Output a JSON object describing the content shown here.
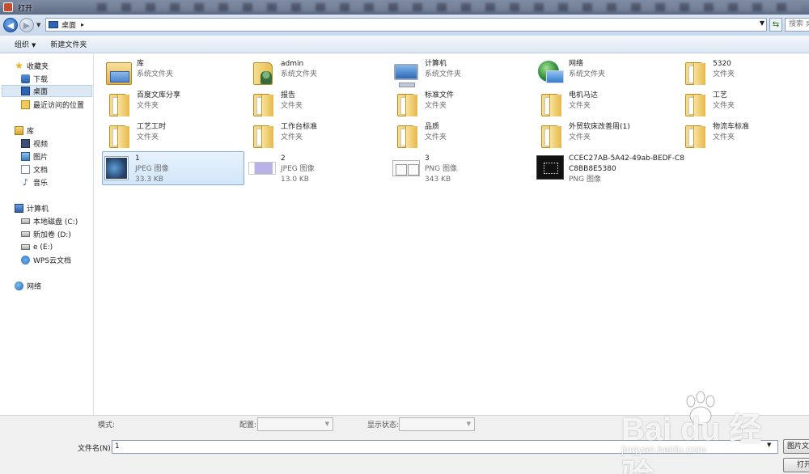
{
  "window": {
    "title": "打开"
  },
  "address": {
    "path": "桌面",
    "search_placeholder": "搜索 桌面"
  },
  "toolbar": {
    "organize": "组织",
    "new_folder": "新建文件夹"
  },
  "sidebar": {
    "favorites": "收藏夹",
    "downloads": "下载",
    "desktop": "桌面",
    "recent": "最近访问的位置",
    "libraries": "库",
    "videos": "视频",
    "pictures": "图片",
    "documents": "文档",
    "music": "音乐",
    "computer": "计算机",
    "drive_c": "本地磁盘 (C:)",
    "drive_d": "新加卷 (D:)",
    "drive_e": "e (E:)",
    "wps_cloud": "WPS云文档",
    "network": "网络"
  },
  "files": [
    {
      "name": "库",
      "type": "系统文件夹"
    },
    {
      "name": "admin",
      "type": "系统文件夹"
    },
    {
      "name": "计算机",
      "type": "系统文件夹"
    },
    {
      "name": "网络",
      "type": "系统文件夹"
    },
    {
      "name": "5320",
      "type": "文件夹"
    },
    {
      "name": "百度文库分享",
      "type": "文件夹"
    },
    {
      "name": "报告",
      "type": "文件夹"
    },
    {
      "name": "标准文件",
      "type": "文件夹"
    },
    {
      "name": "电机马达",
      "type": "文件夹"
    },
    {
      "name": "工艺",
      "type": "文件夹"
    },
    {
      "name": "工艺工时",
      "type": "文件夹"
    },
    {
      "name": "工作台标准",
      "type": "文件夹"
    },
    {
      "name": "品质",
      "type": "文件夹"
    },
    {
      "name": "外贸软床改善周(1)",
      "type": "文件夹"
    },
    {
      "name": "物流车标准",
      "type": "文件夹"
    },
    {
      "name": "1",
      "type": "JPEG 图像",
      "size": "33.3 KB"
    },
    {
      "name": "2",
      "type": "JPEG 图像",
      "size": "13.0 KB"
    },
    {
      "name": "3",
      "type": "PNG 图像",
      "size": "343 KB"
    },
    {
      "name": "CCEC27AB-5A42-49ab-BEDF-C8",
      "name2": "C8BB8E5380",
      "type": "PNG 图像"
    }
  ],
  "bottom": {
    "mode_label": "模式:",
    "config_label": "配置:",
    "display_label": "显示状态:",
    "filename_label": "文件名(N):",
    "filename_value": "1",
    "filetype": "图片文件",
    "open_button": "打开"
  },
  "watermark": {
    "logo_text": "Bai du 经验",
    "url": "jingyan.baidu.com"
  }
}
